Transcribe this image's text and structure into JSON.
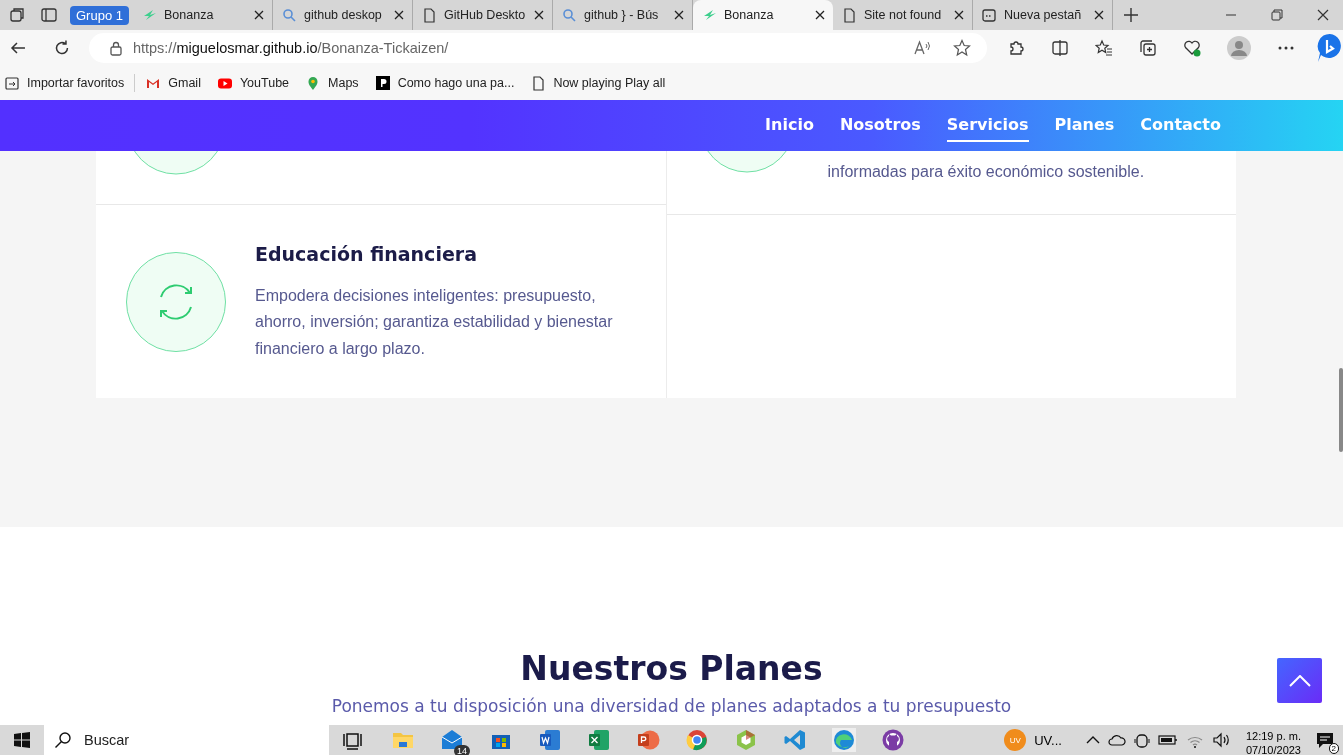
{
  "browser": {
    "tab_group": "Grupo 1",
    "tabs": [
      {
        "title": "Bonanza",
        "kind": "logo",
        "selected": false
      },
      {
        "title": "github deskop",
        "kind": "search",
        "selected": false
      },
      {
        "title": "GitHub Deskto",
        "kind": "page",
        "selected": false
      },
      {
        "title": "github } - Bús",
        "kind": "search",
        "selected": false
      },
      {
        "title": "Bonanza",
        "kind": "logo",
        "selected": true
      },
      {
        "title": "Site not found",
        "kind": "page",
        "selected": false
      },
      {
        "title": "Nueva pestañ",
        "kind": "newtab",
        "selected": false
      }
    ],
    "address": {
      "scheme": "https://",
      "host": "miguelosmar.github.io",
      "path": "/Bonanza-Tickaizen/"
    },
    "bookmarks": [
      {
        "label": "Importar favoritos",
        "kind": "import"
      },
      {
        "label": "Gmail",
        "kind": "mail"
      },
      {
        "label": "YouTube",
        "kind": "video"
      },
      {
        "label": "Maps",
        "kind": "pin"
      },
      {
        "label": "Como hago una pa...",
        "kind": "p"
      },
      {
        "label": "Now playing Play all",
        "kind": "page"
      }
    ]
  },
  "page": {
    "nav": [
      {
        "label": "Inicio",
        "selected": false
      },
      {
        "label": "Nosotros",
        "selected": false
      },
      {
        "label": "Servicios",
        "selected": true
      },
      {
        "label": "Planes",
        "selected": false
      },
      {
        "label": "Contacto",
        "selected": false
      }
    ],
    "services": [
      {
        "text": "informadas para éxito económico sostenible."
      },
      {
        "title": "Educación financiera",
        "text": "Empodera decisiones inteligentes: presupuesto, ahorro, inversión; garantiza estabilidad y bienestar financiero a largo plazo."
      }
    ],
    "plans": {
      "title": "Nuestros Planes",
      "subtitle": "Ponemos a tu disposición una diversidad de planes adaptados a tu presupuesto"
    }
  },
  "taskbar": {
    "search": {
      "placeholder": "Buscar"
    },
    "mail_badge": "14",
    "account": "UV...",
    "avatar": "UV",
    "time": "12:19 p. m.",
    "date": "07/10/2023",
    "notifications": "2"
  }
}
